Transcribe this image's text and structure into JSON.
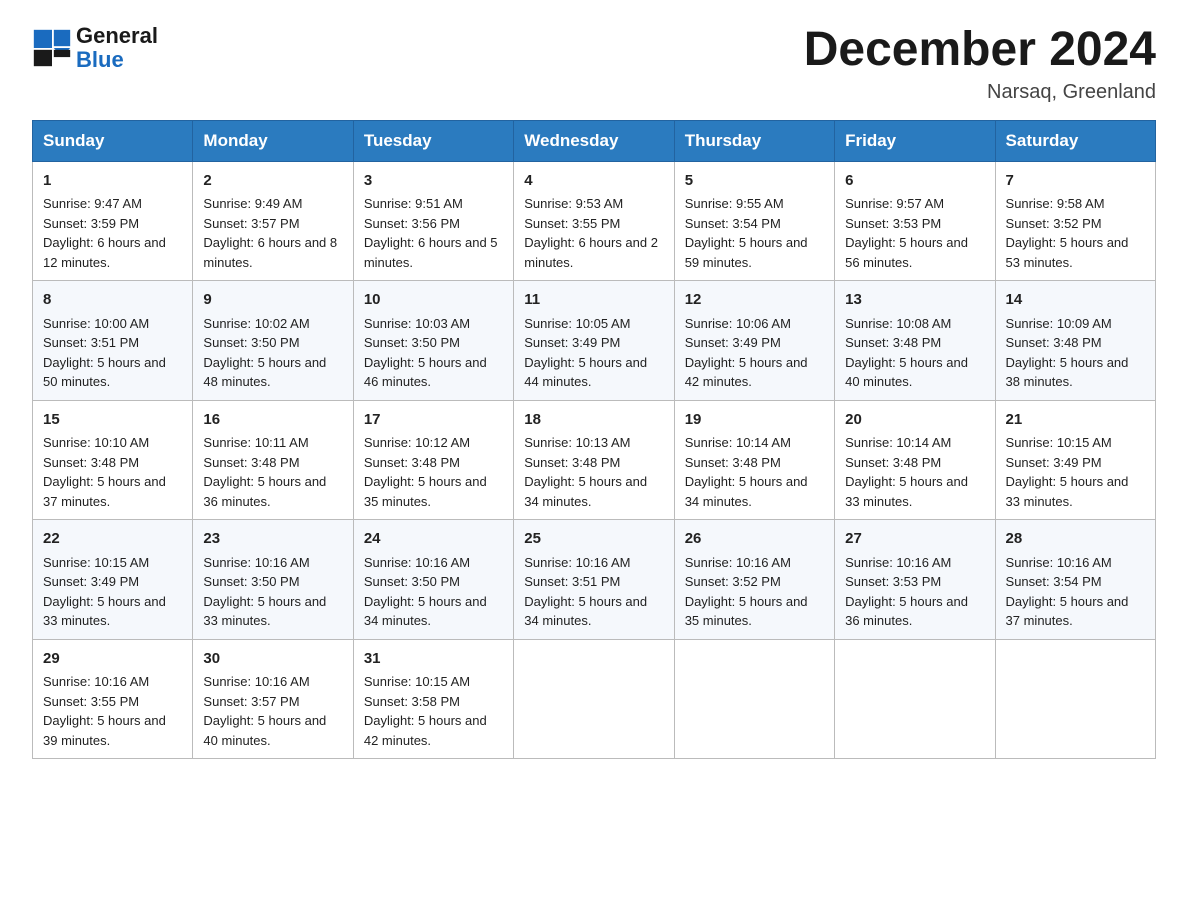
{
  "header": {
    "logo_line1": "General",
    "logo_line2": "Blue",
    "month_title": "December 2024",
    "location": "Narsaq, Greenland"
  },
  "days_of_week": [
    "Sunday",
    "Monday",
    "Tuesday",
    "Wednesday",
    "Thursday",
    "Friday",
    "Saturday"
  ],
  "weeks": [
    [
      {
        "day": "1",
        "sunrise": "9:47 AM",
        "sunset": "3:59 PM",
        "daylight": "6 hours and 12 minutes."
      },
      {
        "day": "2",
        "sunrise": "9:49 AM",
        "sunset": "3:57 PM",
        "daylight": "6 hours and 8 minutes."
      },
      {
        "day": "3",
        "sunrise": "9:51 AM",
        "sunset": "3:56 PM",
        "daylight": "6 hours and 5 minutes."
      },
      {
        "day": "4",
        "sunrise": "9:53 AM",
        "sunset": "3:55 PM",
        "daylight": "6 hours and 2 minutes."
      },
      {
        "day": "5",
        "sunrise": "9:55 AM",
        "sunset": "3:54 PM",
        "daylight": "5 hours and 59 minutes."
      },
      {
        "day": "6",
        "sunrise": "9:57 AM",
        "sunset": "3:53 PM",
        "daylight": "5 hours and 56 minutes."
      },
      {
        "day": "7",
        "sunrise": "9:58 AM",
        "sunset": "3:52 PM",
        "daylight": "5 hours and 53 minutes."
      }
    ],
    [
      {
        "day": "8",
        "sunrise": "10:00 AM",
        "sunset": "3:51 PM",
        "daylight": "5 hours and 50 minutes."
      },
      {
        "day": "9",
        "sunrise": "10:02 AM",
        "sunset": "3:50 PM",
        "daylight": "5 hours and 48 minutes."
      },
      {
        "day": "10",
        "sunrise": "10:03 AM",
        "sunset": "3:50 PM",
        "daylight": "5 hours and 46 minutes."
      },
      {
        "day": "11",
        "sunrise": "10:05 AM",
        "sunset": "3:49 PM",
        "daylight": "5 hours and 44 minutes."
      },
      {
        "day": "12",
        "sunrise": "10:06 AM",
        "sunset": "3:49 PM",
        "daylight": "5 hours and 42 minutes."
      },
      {
        "day": "13",
        "sunrise": "10:08 AM",
        "sunset": "3:48 PM",
        "daylight": "5 hours and 40 minutes."
      },
      {
        "day": "14",
        "sunrise": "10:09 AM",
        "sunset": "3:48 PM",
        "daylight": "5 hours and 38 minutes."
      }
    ],
    [
      {
        "day": "15",
        "sunrise": "10:10 AM",
        "sunset": "3:48 PM",
        "daylight": "5 hours and 37 minutes."
      },
      {
        "day": "16",
        "sunrise": "10:11 AM",
        "sunset": "3:48 PM",
        "daylight": "5 hours and 36 minutes."
      },
      {
        "day": "17",
        "sunrise": "10:12 AM",
        "sunset": "3:48 PM",
        "daylight": "5 hours and 35 minutes."
      },
      {
        "day": "18",
        "sunrise": "10:13 AM",
        "sunset": "3:48 PM",
        "daylight": "5 hours and 34 minutes."
      },
      {
        "day": "19",
        "sunrise": "10:14 AM",
        "sunset": "3:48 PM",
        "daylight": "5 hours and 34 minutes."
      },
      {
        "day": "20",
        "sunrise": "10:14 AM",
        "sunset": "3:48 PM",
        "daylight": "5 hours and 33 minutes."
      },
      {
        "day": "21",
        "sunrise": "10:15 AM",
        "sunset": "3:49 PM",
        "daylight": "5 hours and 33 minutes."
      }
    ],
    [
      {
        "day": "22",
        "sunrise": "10:15 AM",
        "sunset": "3:49 PM",
        "daylight": "5 hours and 33 minutes."
      },
      {
        "day": "23",
        "sunrise": "10:16 AM",
        "sunset": "3:50 PM",
        "daylight": "5 hours and 33 minutes."
      },
      {
        "day": "24",
        "sunrise": "10:16 AM",
        "sunset": "3:50 PM",
        "daylight": "5 hours and 34 minutes."
      },
      {
        "day": "25",
        "sunrise": "10:16 AM",
        "sunset": "3:51 PM",
        "daylight": "5 hours and 34 minutes."
      },
      {
        "day": "26",
        "sunrise": "10:16 AM",
        "sunset": "3:52 PM",
        "daylight": "5 hours and 35 minutes."
      },
      {
        "day": "27",
        "sunrise": "10:16 AM",
        "sunset": "3:53 PM",
        "daylight": "5 hours and 36 minutes."
      },
      {
        "day": "28",
        "sunrise": "10:16 AM",
        "sunset": "3:54 PM",
        "daylight": "5 hours and 37 minutes."
      }
    ],
    [
      {
        "day": "29",
        "sunrise": "10:16 AM",
        "sunset": "3:55 PM",
        "daylight": "5 hours and 39 minutes."
      },
      {
        "day": "30",
        "sunrise": "10:16 AM",
        "sunset": "3:57 PM",
        "daylight": "5 hours and 40 minutes."
      },
      {
        "day": "31",
        "sunrise": "10:15 AM",
        "sunset": "3:58 PM",
        "daylight": "5 hours and 42 minutes."
      },
      null,
      null,
      null,
      null
    ]
  ]
}
